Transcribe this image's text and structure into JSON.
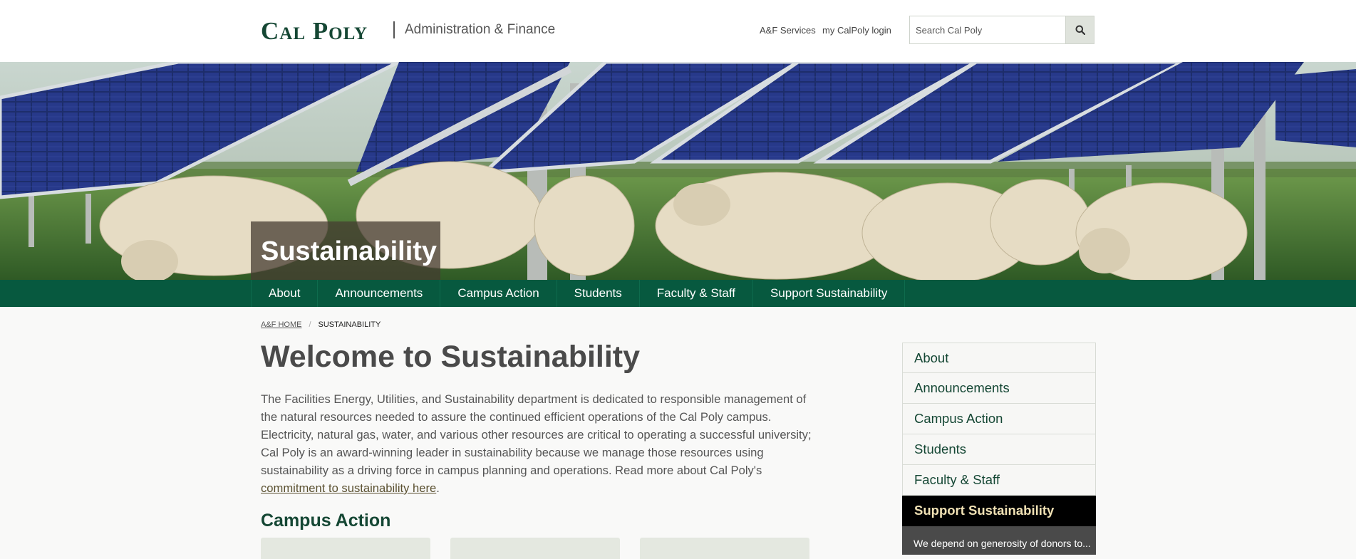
{
  "header": {
    "logo": "Cal Poly",
    "department": "Administration & Finance",
    "links": [
      "A&F Services",
      "my CalPoly login"
    ],
    "search": {
      "placeholder": "Search Cal Poly",
      "icon": "search-icon"
    }
  },
  "hero": {
    "title": "Sustainability",
    "image": "solar-panels-sheep-photo"
  },
  "nav": {
    "items": [
      "About",
      "Announcements",
      "Campus Action",
      "Students",
      "Faculty & Staff",
      "Support Sustainability"
    ]
  },
  "breadcrumb": {
    "home": "A&F Home",
    "separator": "/",
    "current": "Sustainability"
  },
  "main": {
    "title": "Welcome to Sustainability",
    "intro_text": "The Facilities Energy, Utilities, and Sustainability department is dedicated to responsible management of the natural resources needed to assure the continued efficient operations of the Cal Poly campus. Electricity, natural gas, water, and various other resources are critical to operating a successful university; Cal Poly is an award-winning leader in sustainability because we manage those resources using sustainability as a driving force in campus planning and operations. Read more about Cal Poly's ",
    "intro_link": "commitment to sustainability here",
    "intro_end": ".",
    "section_title": "Campus Action"
  },
  "sidebar": {
    "items": [
      "About",
      "Announcements",
      "Campus Action",
      "Students",
      "Faculty & Staff",
      "Support Sustainability"
    ],
    "active_index": 5,
    "extra_text": "We depend on generosity of donors to..."
  },
  "colors": {
    "brand_green": "#154734",
    "nav_green": "#07593f",
    "active_gold": "#f0e1b4"
  }
}
